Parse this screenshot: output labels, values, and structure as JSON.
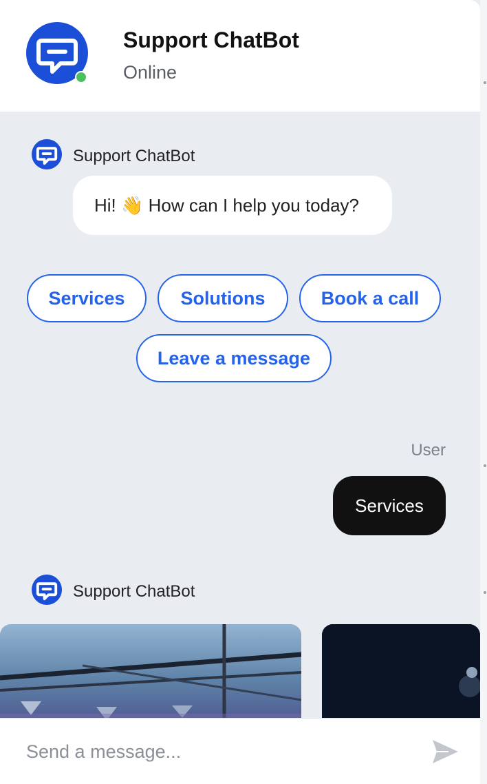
{
  "header": {
    "title": "Support ChatBot",
    "status": "Online"
  },
  "messages": [
    {
      "from": "bot",
      "sender": "Support ChatBot",
      "text": "Hi! 👋 How can I help you today?",
      "quick_replies": [
        "Services",
        "Solutions",
        "Book a call",
        "Leave a message"
      ]
    },
    {
      "from": "user",
      "sender": "User",
      "text": "Services"
    },
    {
      "from": "bot",
      "sender": "Support ChatBot",
      "cards": [
        {
          "image": "service-photo-ceiling-lights"
        },
        {
          "image": "service-photo-dark-scene"
        }
      ]
    }
  ],
  "composer": {
    "placeholder": "Send a message..."
  },
  "colors": {
    "brand": "#1c4fd8",
    "accent": "#2563eb",
    "online": "#4cbf5f",
    "chat_background": "#e9ecf1",
    "user_bubble": "#111111"
  },
  "icons": {
    "avatar": "chat-bubble-icon",
    "send": "send-icon"
  }
}
